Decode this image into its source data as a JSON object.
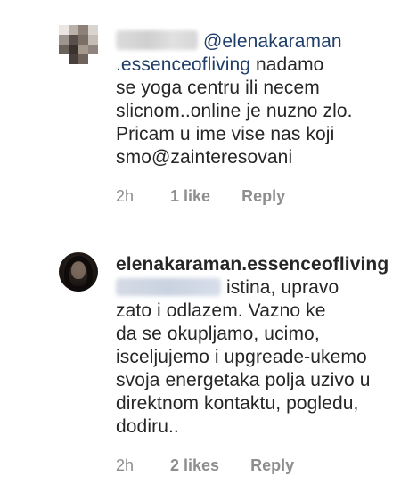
{
  "comments": [
    {
      "author_hidden": true,
      "mention_handle_part1": "@elenakaraman",
      "mention_handle_part2": ".essenceofliving",
      "line1_rest": " nadamo",
      "lines": [
        "se yoga centru ili necem",
        "slicnom..online je nuzno zlo.",
        "Pricam u ime vise nas koji",
        "smo@zainteresovani"
      ],
      "time": "2h",
      "likes": "1 like",
      "reply": "Reply"
    },
    {
      "author": "elenakaraman.essenceofliving",
      "mention_hidden": true,
      "first_line_rest": "istina, upravo",
      "lines": [
        "zato i odlazem. Vazno ke",
        "da se okupljamo, ucimo,",
        "isceljujemo i upgreade-ukemo",
        "svoja energetaka polja uzivo u",
        "direktnom kontaktu, pogledu,",
        "dodiru.."
      ],
      "time": "2h",
      "likes": "2 likes",
      "reply": "Reply"
    }
  ],
  "colors": {
    "text": "#262626",
    "mention": "#1f3e69",
    "meta": "#8e8e8e"
  },
  "icons": {
    "avatar1": "pixelated-avatar",
    "avatar2": "profile-photo-avatar"
  }
}
